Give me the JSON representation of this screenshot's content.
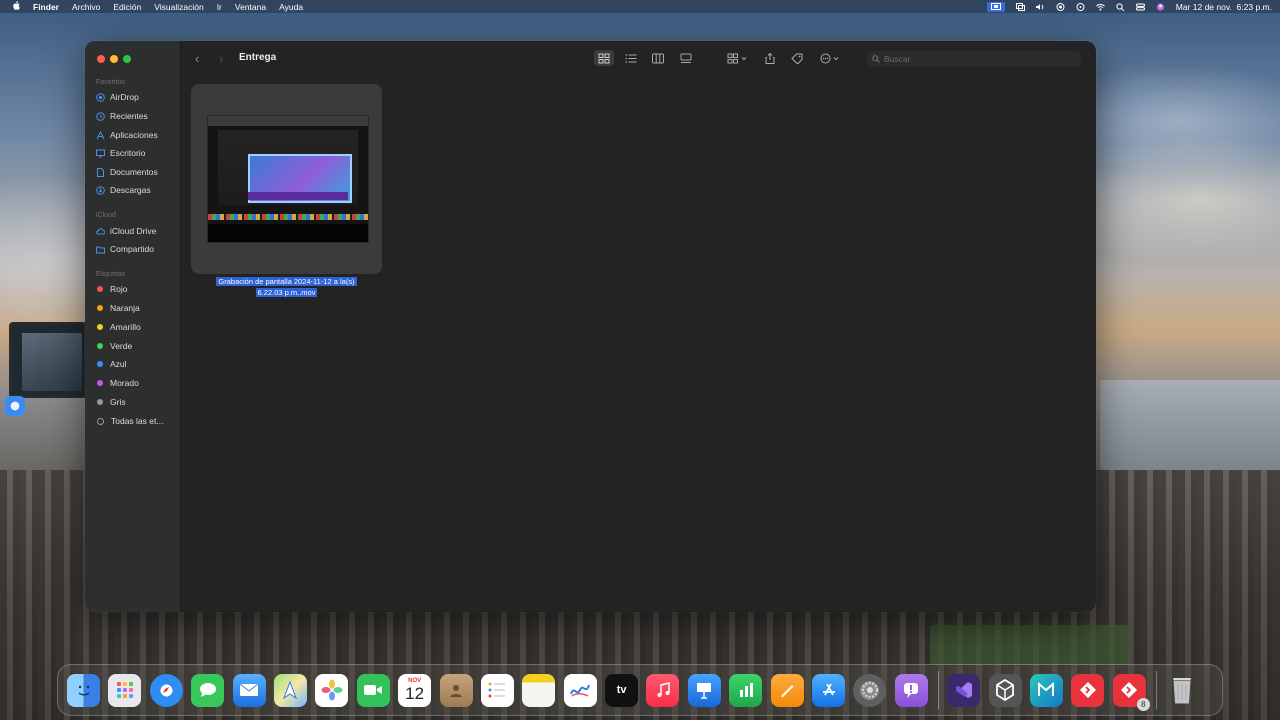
{
  "menubar": {
    "apple": "",
    "app": "Finder",
    "items": [
      "Archivo",
      "Edición",
      "Visualización",
      "Ir",
      "Ventana",
      "Ayuda"
    ],
    "clock": "Mar 12 de nov.  6:23 p.m."
  },
  "finder": {
    "title": "Entrega",
    "search_placeholder": "Buscar",
    "sidebar": {
      "favorites_header": "Favoritos",
      "favorites": [
        {
          "label": "AirDrop",
          "icon": "airdrop-icon"
        },
        {
          "label": "Recientes",
          "icon": "clock-icon"
        },
        {
          "label": "Aplicaciones",
          "icon": "applications-icon"
        },
        {
          "label": "Escritorio",
          "icon": "desktop-icon"
        },
        {
          "label": "Documentos",
          "icon": "document-icon"
        },
        {
          "label": "Descargas",
          "icon": "download-icon"
        }
      ],
      "icloud_header": "iCloud",
      "icloud": [
        {
          "label": "iCloud Drive",
          "icon": "cloud-icon"
        },
        {
          "label": "Compartido",
          "icon": "shared-folder-icon"
        }
      ],
      "tags_header": "Etiquetas",
      "tags": [
        {
          "label": "Rojo",
          "color": "#ff4f4f"
        },
        {
          "label": "Naranja",
          "color": "#ff9f1a"
        },
        {
          "label": "Amarillo",
          "color": "#f5d020"
        },
        {
          "label": "Verde",
          "color": "#3fd65a"
        },
        {
          "label": "Azul",
          "color": "#3b8ff5"
        },
        {
          "label": "Morado",
          "color": "#c45be0"
        },
        {
          "label": "Gris",
          "color": "#9a9a9a"
        },
        {
          "label": "Todas las et...",
          "color": ""
        }
      ]
    },
    "file": {
      "name_line1": "Grabación de pantalla 2024-11-12 a la(s)",
      "name_line2": "6.22.03 p.m..mov"
    }
  },
  "dock": {
    "calendar_month": "NOV",
    "calendar_day": "12",
    "tv_label": "tv",
    "badge_count": "8",
    "apps": [
      "Finder",
      "Launchpad",
      "Safari",
      "Messages",
      "Mail",
      "Maps",
      "Photos",
      "FaceTime",
      "Calendar",
      "Contacts",
      "Reminders",
      "Notes",
      "Freeform",
      "TV",
      "Music",
      "Keynote",
      "Numbers",
      "Pages",
      "App Store",
      "System Settings",
      "Feedback Assistant",
      "Visual Studio",
      "Unity",
      "Unity Hub",
      "Git",
      "GitKraken",
      "Trash"
    ]
  },
  "colors": {
    "selection": "#2f62d6",
    "window_bg": "#222322",
    "sidebar_bg": "#2d2e2e"
  }
}
